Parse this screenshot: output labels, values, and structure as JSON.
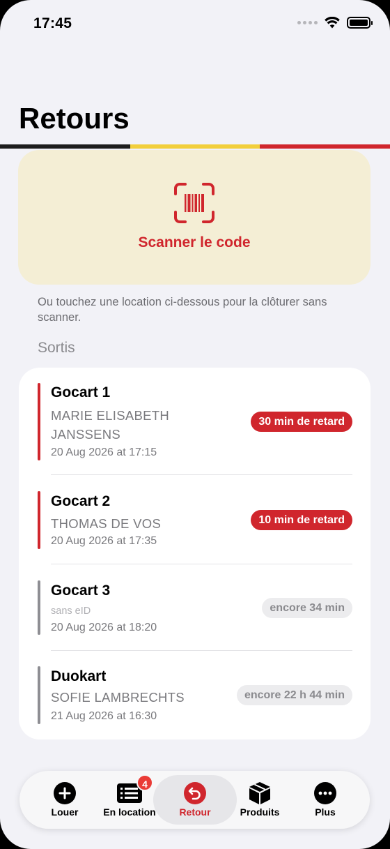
{
  "status_bar": {
    "time": "17:45"
  },
  "header": {
    "title": "Retours"
  },
  "flag_colors": [
    "#1d1d1d",
    "#f2cf3c",
    "#d0262d"
  ],
  "scan": {
    "label": "Scanner le code",
    "icon": "barcode-scan-icon"
  },
  "hint": "Ou touchez une location ci-dessous pour la clôturer sans scanner.",
  "section": {
    "title": "Sortis"
  },
  "rentals": [
    {
      "name": "Gocart 1",
      "client": "MARIE ELISABETH JANSSENS",
      "date": "20 Aug 2026 at 17:15",
      "status": "30 min de retard",
      "late": true
    },
    {
      "name": "Gocart 2",
      "client": "THOMAS DE VOS",
      "date": "20 Aug 2026 at 17:35",
      "status": "10 min de retard",
      "late": true
    },
    {
      "name": "Gocart 3",
      "client": "sans eID",
      "date": "20 Aug 2026 at 18:20",
      "status": "encore 34 min",
      "late": false
    },
    {
      "name": "Duokart",
      "client": "SOFIE LAMBRECHTS",
      "date": "21 Aug 2026 at 16:30",
      "status": "encore 22 h 44 min",
      "late": false
    }
  ],
  "tabs": [
    {
      "label": "Louer",
      "icon": "plus-circle-icon"
    },
    {
      "label": "En location",
      "icon": "list-icon",
      "badge": "4"
    },
    {
      "label": "Retour",
      "icon": "return-arrow-icon",
      "active": true
    },
    {
      "label": "Produits",
      "icon": "box-icon"
    },
    {
      "label": "Plus",
      "icon": "more-icon"
    }
  ],
  "colors": {
    "accent": "#d0262d",
    "late_bar": "#d0262d",
    "ok_bar": "#8e8e93",
    "scan_bg": "#f4eed5"
  }
}
